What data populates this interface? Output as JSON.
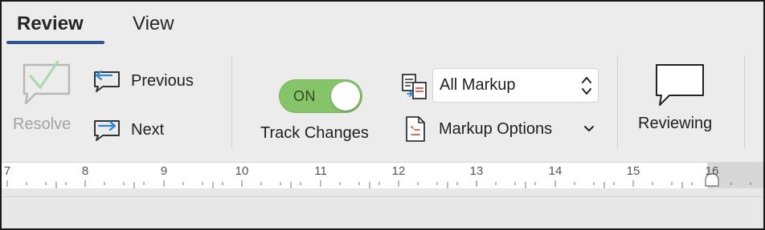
{
  "tabs": [
    {
      "label": "Review",
      "active": true
    },
    {
      "label": "View",
      "active": false
    }
  ],
  "accent": "#2b5597",
  "ribbon": {
    "comments": {
      "resolve_label": "Resolve",
      "resolve_enabled": false,
      "previous_label": "Previous",
      "next_label": "Next"
    },
    "tracking": {
      "toggle_state": "ON",
      "toggle_color": "#86c46a",
      "track_changes_label": "Track Changes",
      "display_for_review": "All Markup",
      "markup_options_label": "Markup Options"
    },
    "reviewing_label": "Reviewing"
  },
  "ruler": {
    "numbers": [
      "7",
      "8",
      "9",
      "10",
      "11",
      "12",
      "13",
      "14",
      "15",
      "16"
    ]
  },
  "icons": [
    "comment-check-icon",
    "previous-comment-icon",
    "next-comment-icon",
    "display-for-review-icon",
    "markup-options-icon",
    "reviewing-pane-icon",
    "updown-chevron-icon",
    "chevron-down-icon",
    "indent-marker-icon"
  ]
}
